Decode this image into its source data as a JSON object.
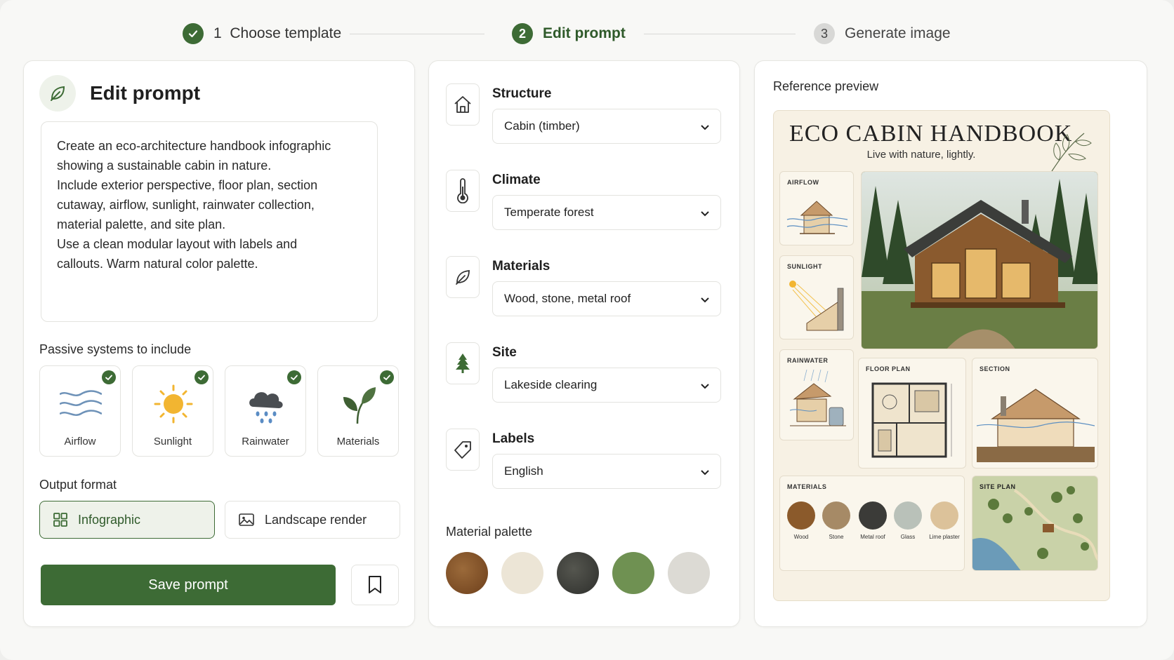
{
  "stepper": {
    "steps": [
      {
        "number": "1",
        "label": "Choose template",
        "state": "done"
      },
      {
        "number": "2",
        "label": "Edit prompt",
        "state": "active"
      },
      {
        "number": "3",
        "label": "Generate image",
        "state": "todo"
      }
    ]
  },
  "editor": {
    "title": "Edit prompt",
    "prompt_text": "Create an eco-architecture handbook infographic\nshowing a sustainable cabin in nature.\nInclude exterior perspective, floor plan, section\ncutaway, airflow, sunlight, rainwater collection,\nmaterial palette, and site plan.\nUse a clean modular layout with labels and\ncallouts. Warm natural color palette.",
    "systems_label": "Passive systems to include",
    "systems": [
      {
        "label": "Airflow",
        "checked": true,
        "icon": "airflow-icon"
      },
      {
        "label": "Sunlight",
        "checked": true,
        "icon": "sun-icon"
      },
      {
        "label": "Rainwater",
        "checked": true,
        "icon": "rain-cloud-icon"
      },
      {
        "label": "Materials",
        "checked": true,
        "icon": "plant-icon"
      }
    ],
    "output_label": "Output format",
    "formats": [
      {
        "label": "Infographic",
        "selected": true,
        "icon": "grid-icon"
      },
      {
        "label": "Landscape render",
        "selected": false,
        "icon": "image-icon"
      }
    ],
    "save_label": "Save prompt"
  },
  "fields": [
    {
      "label": "Structure",
      "value": "Cabin (timber)",
      "icon": "house-icon"
    },
    {
      "label": "Climate",
      "value": "Temperate forest",
      "icon": "thermometer-icon"
    },
    {
      "label": "Materials",
      "value": "Wood, stone, metal roof",
      "icon": "leaf-icon"
    },
    {
      "label": "Site",
      "value": "Lakeside clearing",
      "icon": "tree-icon"
    },
    {
      "label": "Labels",
      "value": "English",
      "icon": "tag-icon"
    }
  ],
  "palette": {
    "label": "Material palette",
    "colors": [
      "#7a4a22",
      "#ece5d6",
      "#3e3f3b",
      "#6f9152",
      "#dcdad4"
    ]
  },
  "preview": {
    "label": "Reference preview",
    "poster_title": "ECO CABIN HANDBOOK",
    "poster_subtitle": "Live with nature, lightly.",
    "panels": {
      "airflow": "AIRFLOW",
      "sunlight": "SUNLIGHT",
      "rainwater": "RAINWATER",
      "floor_plan": "FLOOR PLAN",
      "section": "SECTION",
      "materials": "MATERIALS",
      "site_plan": "SITE PLAN"
    },
    "materials": [
      {
        "name": "Wood",
        "color": "#8b5a2b"
      },
      {
        "name": "Stone",
        "color": "#a68a66"
      },
      {
        "name": "Metal roof",
        "color": "#3b3b38"
      },
      {
        "name": "Glass",
        "color": "#b9c1b9"
      },
      {
        "name": "Lime plaster",
        "color": "#dcc29a"
      }
    ]
  },
  "colors": {
    "accent": "#3d6b35",
    "accent_light": "#eef2ea"
  }
}
